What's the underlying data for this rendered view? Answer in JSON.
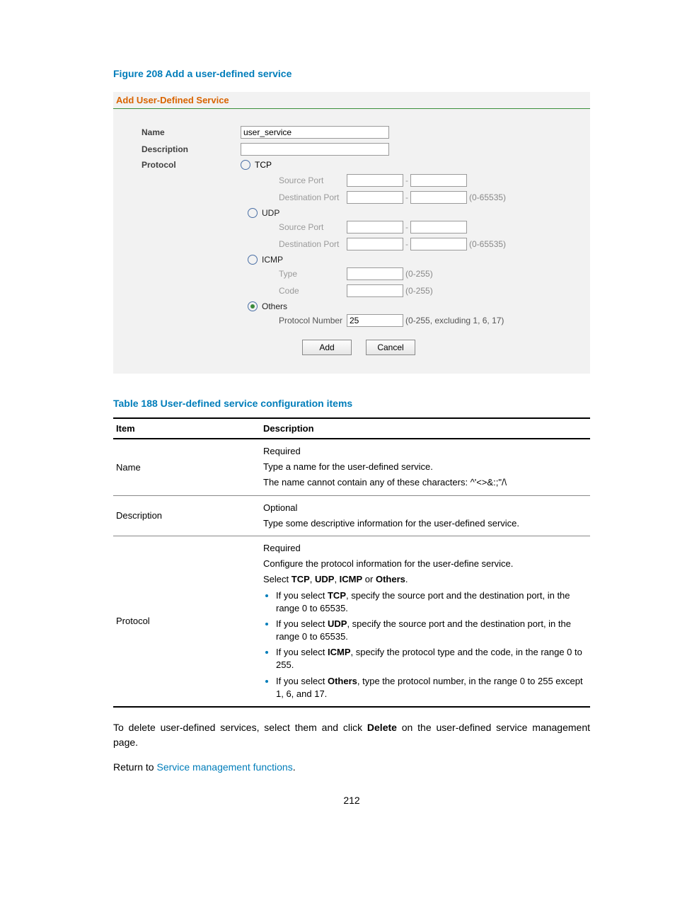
{
  "figure_title": "Figure 208 Add a user-defined service",
  "panel_header": "Add User-Defined Service",
  "form": {
    "name_label": "Name",
    "name_value": "user_service",
    "desc_label": "Description",
    "desc_value": "",
    "protocol_label": "Protocol",
    "tcp": {
      "label": "TCP",
      "source_port_label": "Source Port",
      "dest_port_label": "Destination Port",
      "range_hint": "(0-65535)"
    },
    "udp": {
      "label": "UDP",
      "source_port_label": "Source Port",
      "dest_port_label": "Destination Port",
      "range_hint": "(0-65535)"
    },
    "icmp": {
      "label": "ICMP",
      "type_label": "Type",
      "code_label": "Code",
      "range_hint": "(0-255)"
    },
    "others": {
      "label": "Others",
      "proto_num_label": "Protocol Number",
      "proto_num_value": "25",
      "range_hint": "(0-255, excluding 1, 6, 17)"
    },
    "add_btn": "Add",
    "cancel_btn": "Cancel"
  },
  "table_title": "Table 188 User-defined service configuration items",
  "table": {
    "col1": "Item",
    "col2": "Description",
    "rows": {
      "name": {
        "item": "Name",
        "d1": "Required",
        "d2": "Type a name for the user-defined service.",
        "d3": "The name cannot contain any of these characters: ^'<>&:;\"/\\"
      },
      "description": {
        "item": "Description",
        "d1": "Optional",
        "d2": "Type some descriptive information for the user-defined service."
      },
      "protocol": {
        "item": "Protocol",
        "d1": "Required",
        "d2": "Configure the protocol information for the user-define service.",
        "d3_pre": "Select ",
        "d3_tcp": "TCP",
        "d3_c1": ", ",
        "d3_udp": "UDP",
        "d3_c2": ", ",
        "d3_icmp": "ICMP",
        "d3_c3": " or ",
        "d3_others": "Others",
        "d3_end": ".",
        "b1_pre": "If you select ",
        "b1_b": "TCP",
        "b1_post": ", specify the source port and the destination port, in the range 0 to 65535.",
        "b2_pre": "If you select ",
        "b2_b": "UDP",
        "b2_post": ", specify the source port and the destination port, in the range 0 to 65535.",
        "b3_pre": "If you select ",
        "b3_b": "ICMP",
        "b3_post": ", specify the protocol type and the code, in the range 0 to 255.",
        "b4_pre": "If you select ",
        "b4_b": "Others",
        "b4_post": ", type the protocol number, in the range 0 to 255 except 1, 6, and 17."
      }
    }
  },
  "body": {
    "p1_pre": "To delete user-defined services, select them and click ",
    "p1_b": "Delete",
    "p1_post": " on the user-defined service management page.",
    "p2_pre": "Return to ",
    "p2_link": "Service management functions",
    "p2_post": "."
  },
  "page_number": "212"
}
